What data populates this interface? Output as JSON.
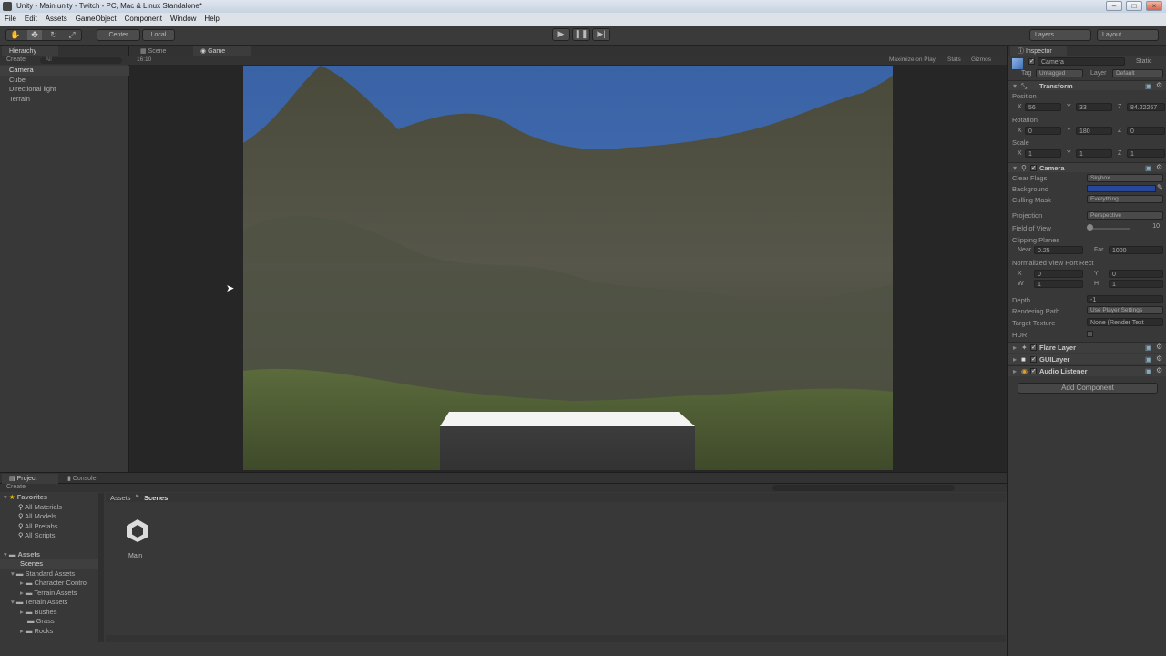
{
  "window": {
    "title": "Unity - Main.unity - Twitch - PC, Mac & Linux Standalone*"
  },
  "menu": [
    "File",
    "Edit",
    "Assets",
    "GameObject",
    "Component",
    "Window",
    "Help"
  ],
  "toolbar": {
    "center": "Center",
    "local": "Local",
    "layers": "Layers",
    "layout": "Layout"
  },
  "hierarchy": {
    "tab": "Hierarchy",
    "create": "Create",
    "search": "All",
    "items": [
      "Camera",
      "Cube",
      "Directional light",
      "Terrain"
    ]
  },
  "view": {
    "tab_scene": "Scene",
    "tab_game": "Game",
    "aspect": "16:10",
    "maximize": "Maximize on Play",
    "stats": "Stats",
    "gizmos": "Gizmos"
  },
  "inspector": {
    "tab": "Inspector",
    "object_name": "Camera",
    "static_label": "Static",
    "tag_label": "Tag",
    "tag_value": "Untagged",
    "layer_label": "Layer",
    "layer_value": "Default",
    "transform": {
      "title": "Transform",
      "position_label": "Position",
      "px": "56",
      "py": "33",
      "pz": "84.22267",
      "rotation_label": "Rotation",
      "rx": "0",
      "ry": "180",
      "rz": "0",
      "scale_label": "Scale",
      "sx": "1",
      "sy": "1",
      "sz": "1"
    },
    "camera": {
      "title": "Camera",
      "clear_flags_label": "Clear Flags",
      "clear_flags": "Skybox",
      "background_label": "Background",
      "culling_label": "Culling Mask",
      "culling": "Everything",
      "projection_label": "Projection",
      "projection": "Perspective",
      "fov_label": "Field of View",
      "fov": "10",
      "clipping_label": "Clipping Planes",
      "near_label": "Near",
      "near": "0.25",
      "far_label": "Far",
      "far": "1000",
      "viewport_label": "Normalized View Port Rect",
      "vx": "0",
      "vy": "0",
      "vw": "1",
      "vh": "1",
      "depth_label": "Depth",
      "depth": "-1",
      "render_path_label": "Rendering Path",
      "render_path": "Use Player Settings",
      "target_label": "Target Texture",
      "target": "None (Render Text",
      "hdr_label": "HDR"
    },
    "components": [
      "Flare Layer",
      "GUILayer",
      "Audio Listener"
    ],
    "add_component": "Add Component"
  },
  "project": {
    "tab_project": "Project",
    "tab_console": "Console",
    "create": "Create",
    "favorites": "Favorites",
    "fav_items": [
      "All Materials",
      "All Models",
      "All Prefabs",
      "All Scripts"
    ],
    "assets": "Assets",
    "asset_tree": [
      "Scenes",
      "Standard Assets",
      "Character Contro",
      "Terrain Assets",
      "Terrain Assets",
      "Bushes",
      "Grass",
      "Rocks"
    ],
    "breadcrumb_root": "Assets",
    "breadcrumb_sep": "►",
    "breadcrumb_leaf": "Scenes",
    "file_name": "Main"
  },
  "colors": {
    "sky": "#3f6cae",
    "editor_bg": "#383838",
    "panel_dark": "#2b2b2b"
  }
}
